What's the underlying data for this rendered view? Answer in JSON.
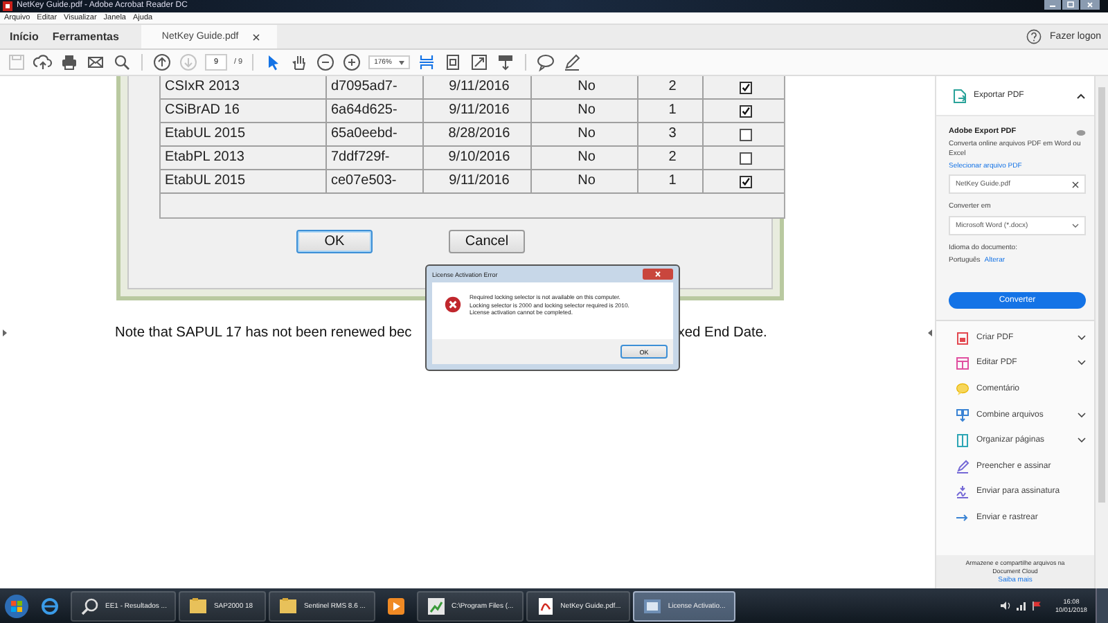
{
  "window": {
    "title": "NetKey Guide.pdf - Adobe Acrobat Reader DC"
  },
  "menu": [
    "Arquivo",
    "Editar",
    "Visualizar",
    "Janela",
    "Ajuda"
  ],
  "tabs": [
    {
      "label": "Início",
      "kind": "nav",
      "selected": false
    },
    {
      "label": "Ferramentas",
      "kind": "nav",
      "selected": false
    },
    {
      "label": "NetKey Guide.pdf",
      "kind": "document",
      "selected": true
    }
  ],
  "account": {
    "label": "Fazer logon"
  },
  "toolbar": {
    "groups": [
      [
        {
          "kind": "save",
          "disabled": true
        },
        {
          "kind": "upload",
          "disabled": false
        },
        {
          "kind": "print",
          "disabled": false
        },
        {
          "kind": "mail",
          "disabled": false
        },
        {
          "kind": "search",
          "disabled": false
        }
      ],
      [
        {
          "kind": "prev",
          "disabled": false
        },
        {
          "kind": "next",
          "disabled": true
        },
        {
          "kind": "page",
          "disabled": false
        }
      ],
      [
        {
          "kind": "pointer",
          "disabled": false
        },
        {
          "kind": "hand",
          "disabled": false
        },
        {
          "kind": "zoomout",
          "disabled": false
        },
        {
          "kind": "zoomin",
          "disabled": false
        },
        {
          "kind": "zoom",
          "disabled": false
        },
        {
          "kind": "fit",
          "disabled": false
        },
        {
          "kind": "pagefit",
          "disabled": false
        },
        {
          "kind": "fullscreen",
          "disabled": false
        },
        {
          "kind": "scroll",
          "disabled": false
        }
      ],
      [
        {
          "kind": "comment",
          "disabled": false
        },
        {
          "kind": "pen",
          "disabled": false
        }
      ]
    ],
    "page": "9",
    "page_count": "/ 9",
    "zoom": "176%"
  },
  "document": {
    "table": {
      "rows": [
        {
          "cells": [
            "CSIxR 2013",
            "d7095ad7-",
            "9/11/2016",
            "No",
            "2"
          ],
          "checked": true
        },
        {
          "cells": [
            "CSiBrAD 16",
            "6a64d625-",
            "9/11/2016",
            "No",
            "1"
          ],
          "checked": true
        },
        {
          "cells": [
            "EtabUL 2015",
            "65a0eebd-",
            "8/28/2016",
            "No",
            "3"
          ],
          "checked": false
        },
        {
          "cells": [
            "EtabPL 2013",
            "7ddf729f-",
            "9/10/2016",
            "No",
            "2"
          ],
          "checked": false
        },
        {
          "cells": [
            "EtabUL 2015",
            "ce07e503-",
            "9/11/2016",
            "No",
            "1"
          ],
          "checked": true
        }
      ]
    },
    "buttons": [
      {
        "label": "OK",
        "selected": true
      },
      {
        "label": "Cancel",
        "selected": false
      }
    ],
    "note_start": "Note that SAPUL 17 has not been renewed bec",
    "note_end": "xed End Date."
  },
  "dialog": {
    "title": "License Activation Error",
    "message_lines": [
      "Required locking selector is not available on this computer.",
      "Locking selector is 2000 and locking selector required is 2010.",
      "License activation cannot be completed."
    ],
    "button": "OK"
  },
  "panel": {
    "section": "Exportar PDF",
    "expanded": true,
    "heading": "Adobe Export PDF",
    "description": "Converta online arquivos PDF em Word ou Excel",
    "select_link": "Selecionar arquivo PDF",
    "file": "NetKey Guide.pdf",
    "convert_label": "Converter em",
    "format": "Microsoft Word (*.docx)",
    "language_label": "Idioma do documento:",
    "language": "Português",
    "change_link": "Alterar",
    "convert_button": "Converter",
    "tools": [
      {
        "label": "Criar PDF",
        "kind": "create",
        "expandable": true
      },
      {
        "label": "Editar PDF",
        "kind": "edit",
        "expandable": true
      },
      {
        "label": "Comentário",
        "kind": "comment",
        "expandable": false
      },
      {
        "label": "Combine arquivos",
        "kind": "combine",
        "expandable": true
      },
      {
        "label": "Organizar páginas",
        "kind": "organize",
        "expandable": true
      },
      {
        "label": "Preencher e assinar",
        "kind": "fill",
        "expandable": false
      },
      {
        "label": "Enviar para assinatura",
        "kind": "sign",
        "expandable": false
      },
      {
        "label": "Enviar e rastrear",
        "kind": "track",
        "expandable": false
      }
    ],
    "footer": "Armazene e compartilhe arquivos na Document Cloud",
    "footer_link": "Saiba mais"
  },
  "taskbar": {
    "items": [
      {
        "kind": "ie",
        "selected": false
      },
      {
        "kind": "search",
        "label": "EE1 - Resultados ...",
        "selected": false
      },
      {
        "kind": "folder",
        "label": "SAP2000 18",
        "selected": false
      },
      {
        "kind": "folder",
        "label": "Sentinel RMS 8.6 ...",
        "selected": false
      },
      {
        "kind": "media",
        "selected": false
      },
      {
        "kind": "app",
        "label": "C:\\Program Files (...",
        "selected": false
      },
      {
        "kind": "pdf",
        "label": "NetKey Guide.pdf...",
        "selected": false
      },
      {
        "kind": "license",
        "label": "License Activatio...",
        "selected": true
      }
    ],
    "time": "16:08",
    "date": "10/01/2018"
  }
}
